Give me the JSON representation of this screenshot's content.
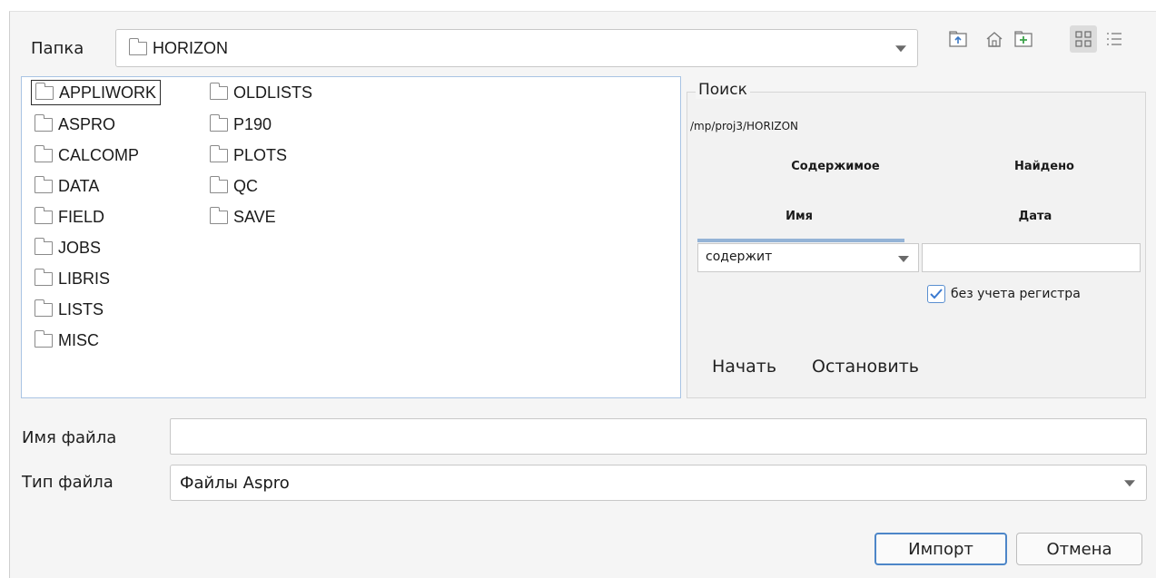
{
  "folder": {
    "label": "Папка",
    "current": "HORIZON"
  },
  "toolbar": {
    "icons": [
      "up-folder-icon",
      "home-icon",
      "new-folder-icon",
      "grid-view-icon",
      "list-view-icon"
    ]
  },
  "files": [
    "APPLIWORK",
    "ASPRO",
    "CALCOMP",
    "DATA",
    "FIELD",
    "JOBS",
    "LIBRIS",
    "LISTS",
    "MISC",
    "OLDLISTS",
    "P190",
    "PLOTS",
    "QC",
    "SAVE"
  ],
  "search": {
    "legend": "Поиск",
    "path": "/mp/proj3/HORIZON",
    "tab_contents": "Содержимое",
    "tab_found": "Найдено",
    "tab_name": "Имя",
    "tab_date": "Дата",
    "condition": "содержит",
    "case_insensitive": "без учета регистра",
    "start": "Начать",
    "stop": "Остановить"
  },
  "filename": {
    "label": "Имя файла",
    "value": ""
  },
  "filetype": {
    "label": "Тип файла",
    "value": "Файлы Aspro"
  },
  "buttons": {
    "import": "Импорт",
    "cancel": "Отмена"
  },
  "colors": {
    "accent": "#4d86c8",
    "list_border": "#a9c4e4",
    "tab_underline": "#94b3d6"
  }
}
